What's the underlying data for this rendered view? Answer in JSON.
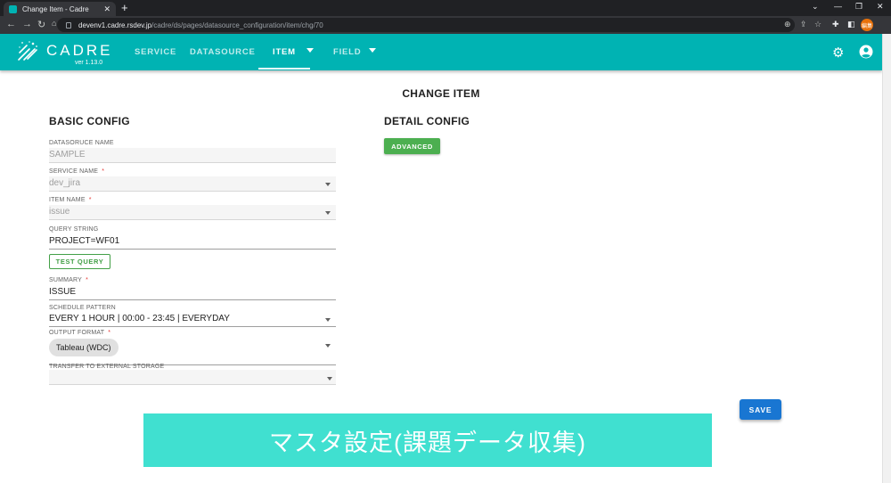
{
  "browser": {
    "tab_title": "Change Item - Cadre",
    "tab_close": "✕",
    "new_tab": "+",
    "url_host": "devenv1.cadre.rsdev.jp",
    "url_path": "/cadre/ds/pages/datasource_configuration/item/chg/70",
    "profile_badge": "編集"
  },
  "app": {
    "logo": "CADRE",
    "version": "ver 1.13.0",
    "nav": [
      {
        "label": "SERVICE"
      },
      {
        "label": "DATASOURCE"
      },
      {
        "label": "ITEM",
        "active": true
      },
      {
        "label": "FIELD"
      }
    ],
    "accent_color": "#00b3b3"
  },
  "page": {
    "title": "CHANGE ITEM",
    "basic_title": "BASIC CONFIG",
    "detail_title": "DETAIL CONFIG",
    "advanced_label": "ADVANCED",
    "save_label": "SAVE",
    "test_query_label": "TEST QUERY"
  },
  "fields": {
    "datasource_name": {
      "label": "DATASORUCE NAME",
      "value": "SAMPLE"
    },
    "service_name": {
      "label": "SERVICE NAME",
      "value": "dev_jira",
      "required": "*"
    },
    "item_name": {
      "label": "ITEM NAME",
      "value": "issue",
      "required": "*"
    },
    "query_string": {
      "label": "QUERY STRING",
      "value": "PROJECT=WF01"
    },
    "summary": {
      "label": "SUMMARY",
      "value": "ISSUE",
      "required": "*"
    },
    "schedule_pattern": {
      "label": "SCHEDULE PATTERN",
      "value": "EVERY 1 HOUR | 00:00 - 23:45 | EVERYDAY"
    },
    "output_format": {
      "label": "OUTPUT FORMAT",
      "value": "Tableau (WDC)",
      "required": "*"
    },
    "transfer_storage": {
      "label": "TRANSFER TO EXTERNAL STORAGE",
      "value": ""
    }
  },
  "banner": {
    "text": "マスタ設定(課題データ収集)",
    "color": "#40e0d0"
  }
}
